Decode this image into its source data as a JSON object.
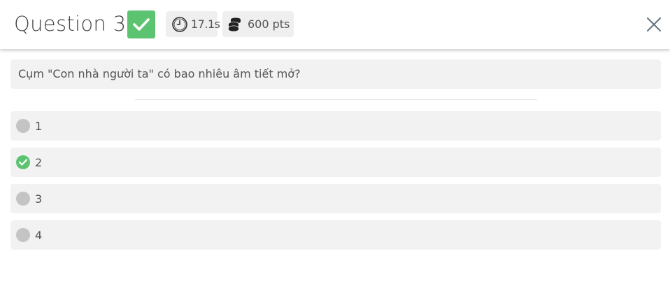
{
  "header": {
    "title": "Question 3",
    "correct_icon": "checkmark-icon",
    "time": "17.1s",
    "time_icon": "clock-icon",
    "points": "600 pts",
    "points_icon": "coins-icon",
    "close_icon": "close-icon"
  },
  "question": {
    "text": "Cụm \"Con nhà người ta\" có bao nhiêu âm tiết mở?"
  },
  "options": [
    {
      "label": "1",
      "state": "unselected"
    },
    {
      "label": "2",
      "state": "correct"
    },
    {
      "label": "3",
      "state": "unselected"
    },
    {
      "label": "4",
      "state": "unselected"
    }
  ],
  "colors": {
    "correct": "#5cc471",
    "unselected": "#c4c4c4",
    "option_bg": "#f2f2f2",
    "text": "#555555"
  }
}
